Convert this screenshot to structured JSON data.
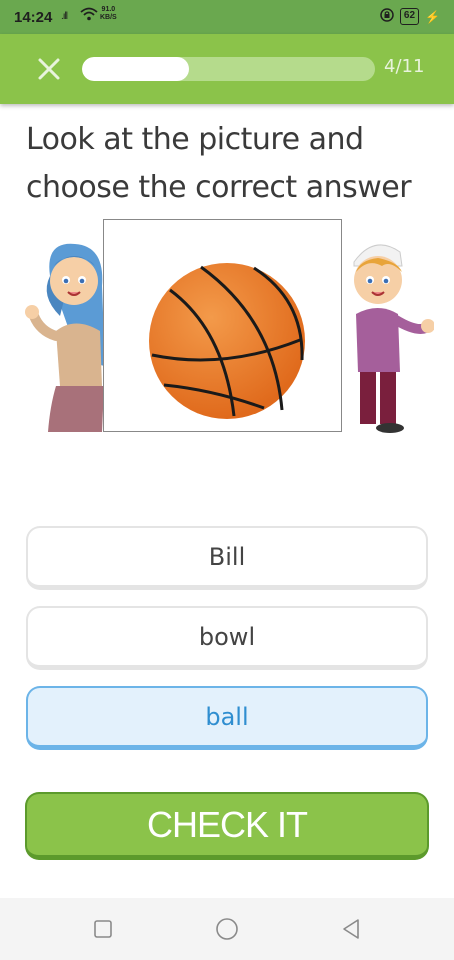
{
  "status_bar": {
    "time": "14:24",
    "signal": ".ıll",
    "net_speed_value": "91.0",
    "net_speed_unit": "KB/S",
    "battery": "62",
    "icons": [
      "signal-icon",
      "wifi-icon",
      "lock-rotation-icon",
      "battery-icon",
      "charging-icon"
    ]
  },
  "header": {
    "close_icon": "close-icon",
    "progress": {
      "current": 4,
      "total": 11,
      "fraction": 0.364
    },
    "progress_label": "4/11",
    "colors": {
      "bar": "#8bc34a",
      "track": "#b5db8c",
      "fill": "#ffffff"
    }
  },
  "question": {
    "line1": "Look at the picture and",
    "line2": "choose the correct answer"
  },
  "picture": {
    "subject": "basketball-image",
    "decor": [
      "girl-character",
      "boy-character"
    ]
  },
  "options": [
    {
      "label": "Bill",
      "selected": false
    },
    {
      "label": "bowl",
      "selected": false
    },
    {
      "label": "ball",
      "selected": true
    }
  ],
  "check_button": {
    "label": "CHECK IT"
  },
  "nav_bar": {
    "icons": [
      "recent-apps-icon",
      "home-icon",
      "back-icon"
    ]
  },
  "colors": {
    "accent": "#8bc34a",
    "selected_bg": "#e3f1fc",
    "selected_border": "#6cb4e8",
    "selected_text": "#2f8ed0"
  }
}
